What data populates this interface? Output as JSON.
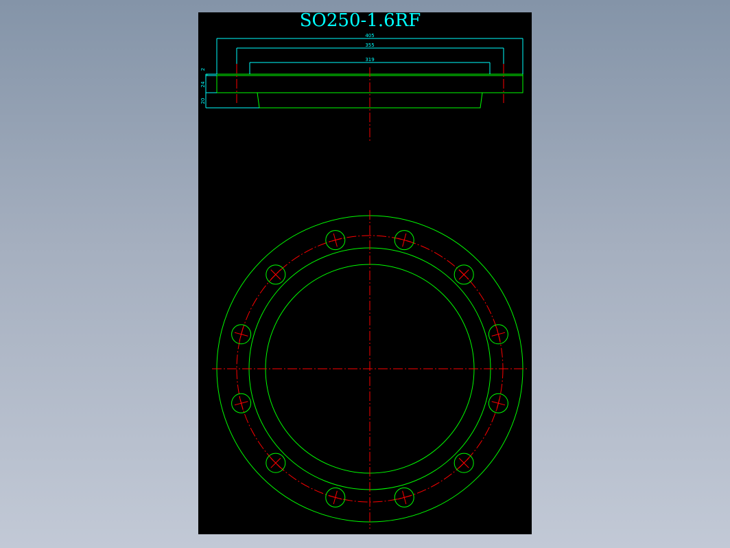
{
  "drawing": {
    "title": "SO250-1.6RF",
    "colors": {
      "background": "#000000",
      "outline": "#00ff00",
      "dimension": "#00ffff",
      "centerline": "#ff0000"
    },
    "dimensions": {
      "width_405": "405",
      "width_355": "355",
      "width_319": "319",
      "height_2": "2",
      "height_24": "24",
      "height_20": "20"
    },
    "bolt_hole_count": 12
  }
}
